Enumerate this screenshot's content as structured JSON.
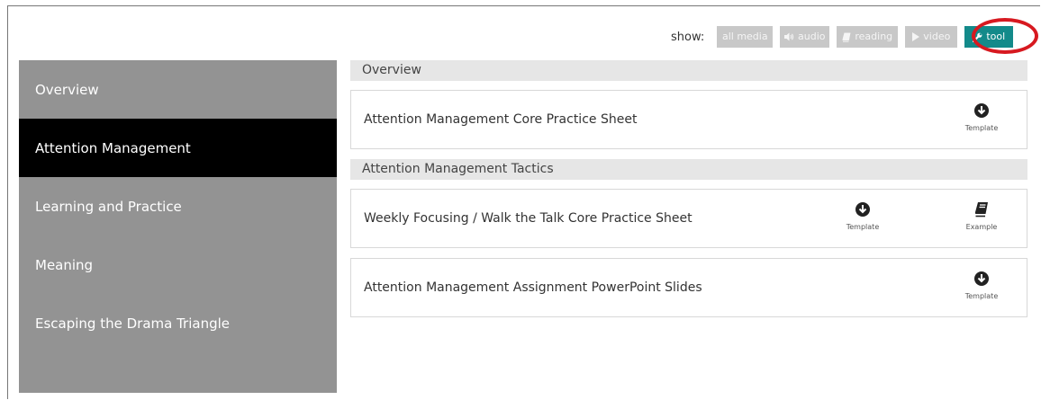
{
  "filter": {
    "label": "show:",
    "buttons": [
      {
        "id": "all",
        "label": "all media",
        "icon": ""
      },
      {
        "id": "audio",
        "label": "audio",
        "icon": "speaker-icon"
      },
      {
        "id": "reading",
        "label": "reading",
        "icon": "book-icon"
      },
      {
        "id": "video",
        "label": "video",
        "icon": "play-icon"
      },
      {
        "id": "tool",
        "label": "tool",
        "icon": "wrench-icon",
        "active": true
      }
    ],
    "active_color": "#138a8a",
    "highlight_color": "#d71920"
  },
  "sidebar": {
    "items": [
      {
        "label": "Overview",
        "active": false
      },
      {
        "label": "Attention Management",
        "active": true
      },
      {
        "label": "Learning and Practice",
        "active": false
      },
      {
        "label": "Meaning",
        "active": false
      },
      {
        "label": "Escaping the Drama Triangle",
        "active": false
      }
    ]
  },
  "main": {
    "sections": [
      {
        "header": "Overview",
        "cards": [
          {
            "title": "Attention Management Core Practice Sheet",
            "actions": [
              {
                "label": "Template",
                "icon": "download-icon"
              }
            ]
          }
        ]
      },
      {
        "header": "Attention Management Tactics",
        "cards": [
          {
            "title": "Weekly Focusing / Walk the Talk Core Practice Sheet",
            "actions": [
              {
                "label": "Template",
                "icon": "download-icon"
              },
              {
                "label": "Example",
                "icon": "book-icon"
              }
            ]
          },
          {
            "title": "Attention Management Assignment PowerPoint Slides",
            "actions": [
              {
                "label": "Template",
                "icon": "download-icon"
              }
            ]
          }
        ]
      }
    ]
  }
}
